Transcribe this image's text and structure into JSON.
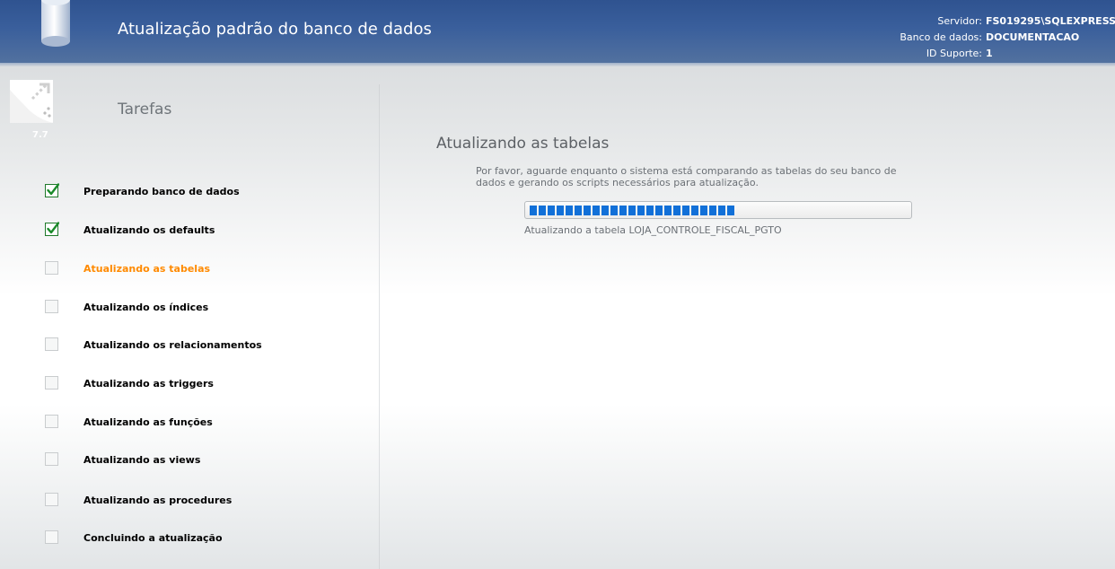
{
  "header": {
    "title": "Atualização padrão do banco de dados",
    "icon": "database-cylinder-icon",
    "server_label": "Servidor:",
    "server_value": "FS019295\\SQLEXPRESS",
    "database_label": "Banco de dados:",
    "database_value": "DOCUMENTACAO",
    "support_label": "ID Suporte:",
    "support_value": "1"
  },
  "sidebar": {
    "logo_icon": "app-logo-icon",
    "version": "7.7",
    "title": "Tarefas",
    "tasks": [
      {
        "label": "Preparando banco de dados",
        "status": "done"
      },
      {
        "label": "Atualizando os defaults",
        "status": "done"
      },
      {
        "label": "Atualizando as tabelas",
        "status": "active"
      },
      {
        "label": "Atualizando os índices",
        "status": "pending"
      },
      {
        "label": "Atualizando os relacionamentos",
        "status": "pending"
      },
      {
        "label": "Atualizando as triggers",
        "status": "pending"
      },
      {
        "label": "Atualizando as funções",
        "status": "pending"
      },
      {
        "label": "Atualizando as views",
        "status": "pending"
      },
      {
        "label": "Atualizando as procedures",
        "status": "pending"
      },
      {
        "label": "Concluindo a atualização",
        "status": "pending"
      }
    ]
  },
  "main": {
    "title": "Atualizando as tabelas",
    "description": "Por favor, aguarde enquanto o sistema está comparando as tabelas do seu banco de dados e gerando os scripts necessários para atualização.",
    "progress_fraction": 0.55,
    "status": "Atualizando a tabela LOJA_CONTROLE_FISCAL_PGTO"
  },
  "colors": {
    "header_blue": "#2f5390",
    "active_task": "#ff8a00",
    "progress_blue": "#1170d8",
    "check_green": "#1f7a2b"
  }
}
